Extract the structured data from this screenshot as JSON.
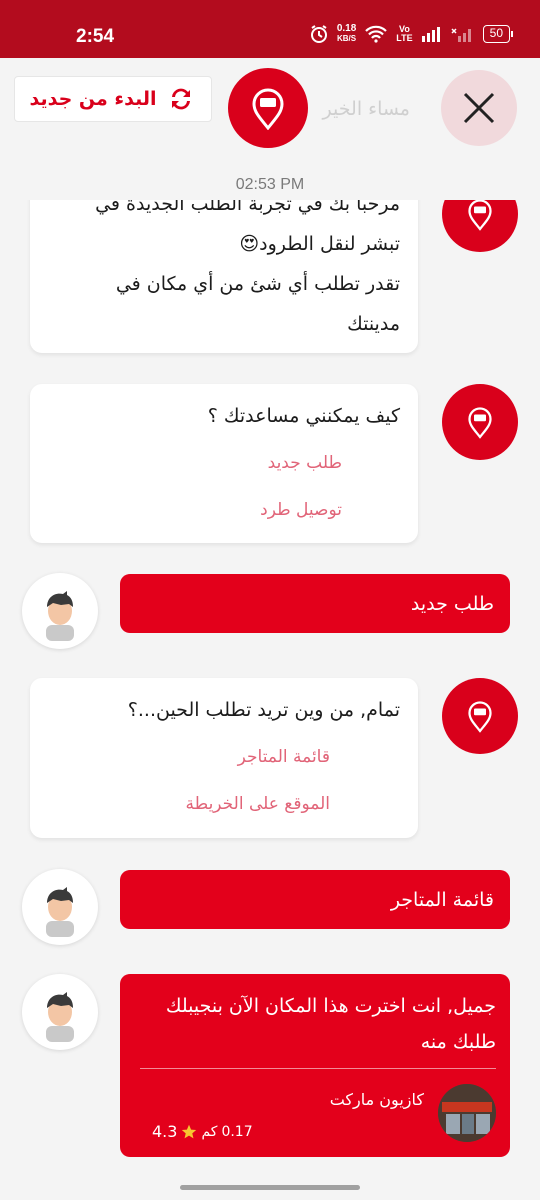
{
  "status_bar": {
    "time": "2:54",
    "net_speed_value": "0.18",
    "net_speed_unit": "KB/S",
    "volte_top": "Vo",
    "volte_bottom": "LTE",
    "battery": "50"
  },
  "header": {
    "restart_label": "البدء من جديد",
    "greeting": "مساء الخير",
    "timestamp": "02:53 PM"
  },
  "messages": {
    "welcome": {
      "line1": "مرحبا بك في تجربة الطلب الجديدة في",
      "line2": "تبشر لنقل الطرود😍",
      "line3": " تقدر تطلب أي شئ من أي مكان في",
      "line4": "مدينتك"
    },
    "help": {
      "question": "كيف يمكنني مساعدتك ؟",
      "options": [
        "طلب جديد",
        "توصيل طرد"
      ]
    },
    "user_reply_1": "طلب جديد",
    "location": {
      "question": "تمام, من وين تريد تطلب الحين...؟",
      "options": [
        "قائمة المتاجر",
        "الموقع على الخريطة"
      ]
    },
    "user_reply_2": "قائمة المتاجر",
    "place": {
      "message": "جميل, انت اخترت هذا المكان الآن بنجيبلك طلبك منه",
      "store_name": "كازيون ماركت",
      "distance_value": "0.17",
      "distance_unit": "كم",
      "rating": "4.3"
    }
  },
  "colors": {
    "brand_red": "#d9001b",
    "status_bar": "#b30c1e",
    "option_pink": "#e16478"
  }
}
